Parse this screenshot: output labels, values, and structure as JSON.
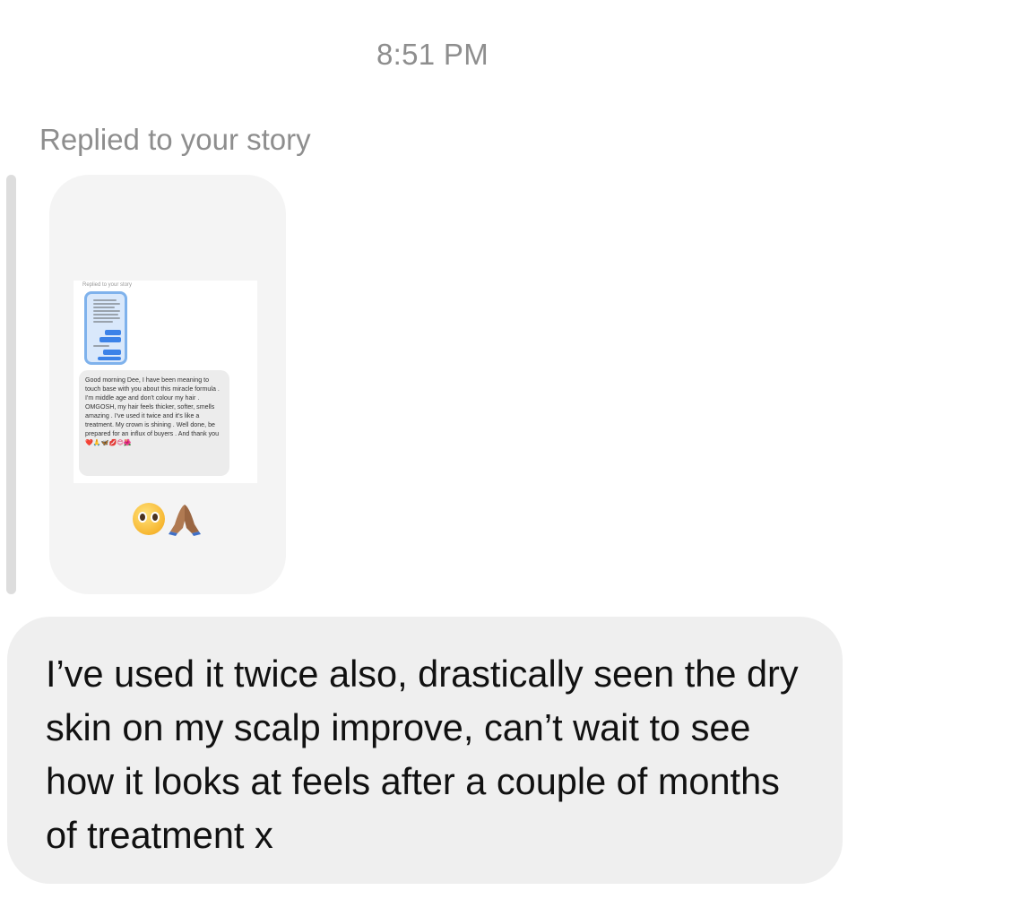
{
  "thread": {
    "timestamp": "8:51 PM",
    "reply_label": "Replied to your story"
  },
  "story": {
    "screenshot_label": "Replied to your story",
    "screenshot_message": "Good morning Dee, I have been meaning to touch base with you about this miracle formula . I'm middle age and don't colour my hair . OMGOSH, my hair feels thicker, softer, smells amazing . I've used it twice and it's like a treatment. My crown is shining . Well done, be prepared for an influx of buyers . And thank you",
    "screenshot_emojis": "❤️🙏🦋💋😊🌺",
    "reaction_emojis": [
      "pleading-face",
      "folded-hands"
    ]
  },
  "message": {
    "text": "I’ve used it twice also, drastically seen the dry skin on my scalp improve, can’t wait to see how it looks at feels after a couple of months of treatment x"
  },
  "colors": {
    "background": "#ffffff",
    "bubble": "#efefef",
    "story_card": "#f4f4f4",
    "meta_text": "#8e8e8e",
    "reply_bar": "#dddddd"
  }
}
